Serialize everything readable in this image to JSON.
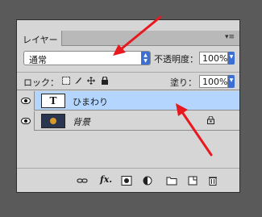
{
  "panel": {
    "tab_label": "レイヤー",
    "menu_glyph": "▾≡",
    "collapse_glyph": "◂◂"
  },
  "blend": {
    "mode": "通常",
    "opacity_label": "不透明度：",
    "opacity_value": "100%"
  },
  "lock": {
    "label": "ロック：",
    "fill_label": "塗り：",
    "fill_value": "100%"
  },
  "layers": [
    {
      "name": "ひまわり",
      "thumb_glyph": "T",
      "selected": true,
      "visible": true,
      "locked": false
    },
    {
      "name": "背景",
      "selected": false,
      "visible": true,
      "locked": true
    }
  ],
  "bottom_toolbar": {
    "fx_label": "fx."
  },
  "colors": {
    "panel_bg": "#d6d6d6",
    "selection": "#b4d5fe",
    "accent_blue": "#3b6fd4",
    "annotation_red": "#e8191e"
  }
}
